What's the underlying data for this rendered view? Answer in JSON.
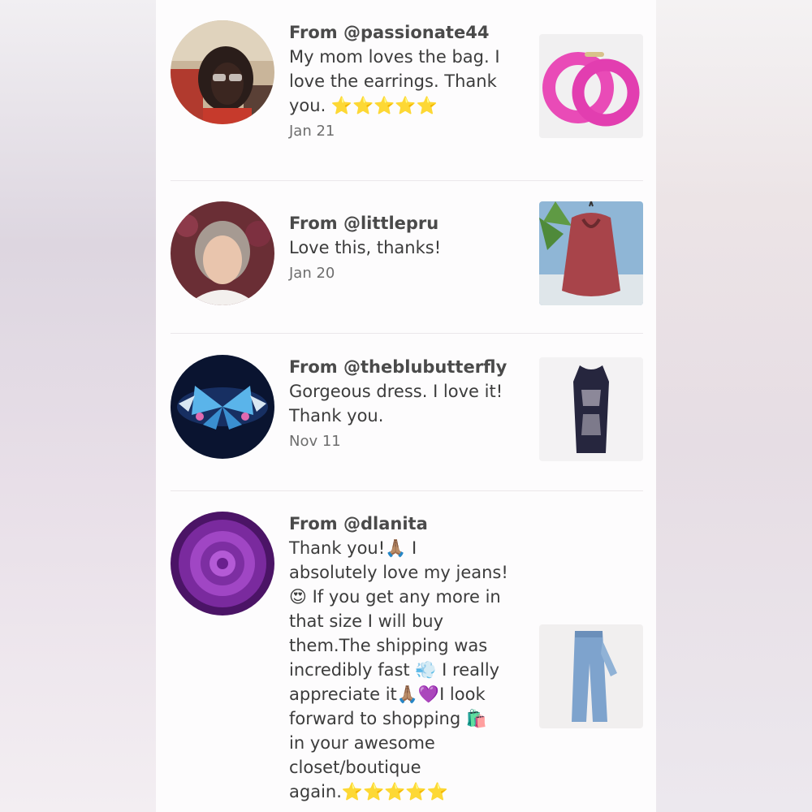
{
  "reviews": [
    {
      "from": "From @passionate44",
      "message_lines": [
        "My mom loves the bag. I",
        "love the earrings. Thank",
        "you. ⭐⭐⭐⭐⭐"
      ],
      "date": "Jan 21",
      "product_icon": "pink-earrings-photo"
    },
    {
      "from": "From @littlepru",
      "message_lines": [
        "Love this, thanks!"
      ],
      "date": "Jan 20",
      "product_icon": "red-sequin-top-photo"
    },
    {
      "from": "From @theblubutterfly",
      "message_lines": [
        "Gorgeous dress. I love it!",
        "Thank you."
      ],
      "date": "Nov 11",
      "product_icon": "lace-dress-photo"
    },
    {
      "from": "From @dlanita",
      "message_lines": [
        "Thank you!🙏🏽 I",
        "absolutely love my jeans!",
        "😍 If you get any more in",
        "that size I will buy",
        "them.The shipping was",
        "incredibly fast 💨 I really",
        "appreciate it🙏🏽💜I look",
        "forward to shopping 🛍️",
        "in your awesome",
        "closet/boutique",
        "again.⭐⭐⭐⭐⭐"
      ],
      "date": "",
      "product_icon": "jeans-photo"
    }
  ],
  "colors": {
    "panel": "#fdfcfd",
    "username": "#4a4a4a",
    "message": "#3c3c3c",
    "date": "#6e6e6e",
    "divider": "#ebe7ea"
  }
}
